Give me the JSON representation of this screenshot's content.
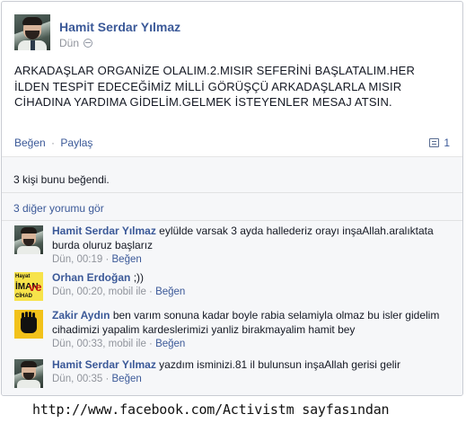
{
  "post": {
    "author": "Hamit Serdar Yılmaz",
    "time": "Dün",
    "text": "ARKADAŞLAR ORGANİZE OLALIM.2.MISIR SEFERİNİ BAŞLATALIM.HER İLDEN TESPİT EDECEĞİMİZ MİLLİ GÖRÜŞÇÜ ARKADAŞLARLA MISIR CİHADINA YARDIMA GİDELİM.GELMEK İSTEYENLER MESAJ ATSIN."
  },
  "actions": {
    "like": "Beğen",
    "separator": "·",
    "share": "Paylaş",
    "comment_count": "1"
  },
  "likes_summary": "3 kişi bunu beğendi.",
  "more_comments": "3 diğer yorumu gör",
  "comments": [
    {
      "author": "Hamit Serdar Yılmaz",
      "text": "eylülde varsak 3 ayda hallederiz orayı inşaAllah.aralıktata burda oluruz başlarız",
      "time": "Dün, 00:19",
      "like": "Beğen",
      "avatar_icon": "profile-photo"
    },
    {
      "author": "Orhan Erdoğan",
      "text": ";))",
      "time": "Dün, 00:20, mobil ile",
      "like": "Beğen",
      "avatar_icon": "yellow-poster-photo",
      "avatar_text": [
        "Hayat",
        "İMAN",
        "ve",
        "CİHAD"
      ]
    },
    {
      "author": "Zakir Aydın",
      "text": "ben varım sonuna kadar boyle rabia selamiyla olmaz bu isler gidelim cihadimizi yapalim kardeslerimizi yanliz birakmayalim hamit bey",
      "time": "Dün, 00:33, mobil ile",
      "like": "Beğen",
      "avatar_icon": "rabia-hand-sign"
    },
    {
      "author": "Hamit Serdar Yılmaz",
      "text": "yazdım isminizi.81 il bulunsun inşaAllah gerisi gelir",
      "time": "Dün, 00:35",
      "like": "Beğen",
      "avatar_icon": "profile-photo"
    }
  ],
  "footer": "http://www.facebook.com/Activistm sayfasından",
  "colors": {
    "link": "#3b5998",
    "meta": "#90949c",
    "ufi_background": "#f6f7f9"
  }
}
